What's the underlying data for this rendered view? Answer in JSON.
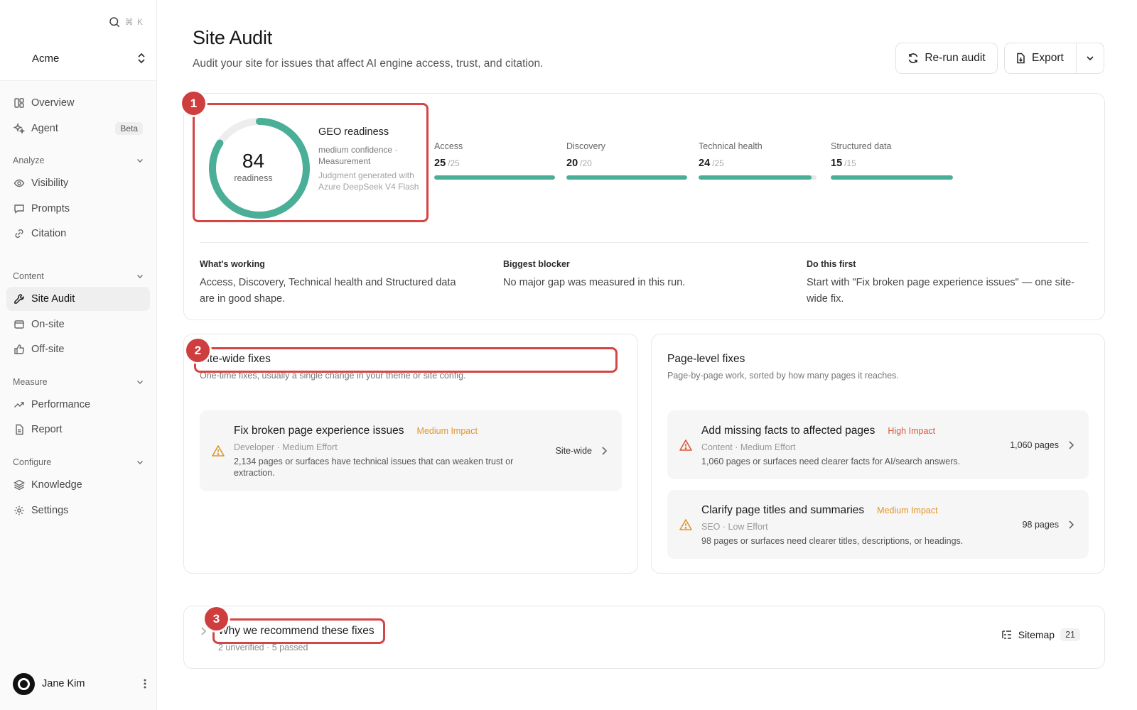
{
  "sidebar": {
    "search_shortcut": "⌘ K",
    "workspace": "Acme",
    "top_items": [
      {
        "label": "Overview",
        "icon": "layout-icon"
      },
      {
        "label": "Agent",
        "icon": "sparkle-icon",
        "badge": "Beta"
      }
    ],
    "sections": [
      {
        "title": "Analyze",
        "items": [
          {
            "label": "Visibility",
            "icon": "eye-icon"
          },
          {
            "label": "Prompts",
            "icon": "message-icon"
          },
          {
            "label": "Citation",
            "icon": "link-icon"
          }
        ]
      },
      {
        "title": "Content",
        "items": [
          {
            "label": "Site Audit",
            "icon": "wrench-icon",
            "active": true
          },
          {
            "label": "On-site",
            "icon": "browser-icon"
          },
          {
            "label": "Off-site",
            "icon": "thumbs-up-icon"
          }
        ]
      },
      {
        "title": "Measure",
        "items": [
          {
            "label": "Performance",
            "icon": "trend-icon"
          },
          {
            "label": "Report",
            "icon": "file-icon"
          }
        ]
      },
      {
        "title": "Configure",
        "items": [
          {
            "label": "Knowledge",
            "icon": "layers-icon"
          },
          {
            "label": "Settings",
            "icon": "gear-icon"
          }
        ]
      }
    ],
    "user": {
      "name": "Jane Kim"
    }
  },
  "header": {
    "title": "Site Audit",
    "subtitle": "Audit your site for issues that affect AI engine access, trust, and citation.",
    "rerun_label": "Re-run audit",
    "export_label": "Export"
  },
  "overview": {
    "marker": "1",
    "score": "84",
    "score_fraction": 0.84,
    "score_label": "readiness",
    "geo_title": "GEO readiness",
    "confidence": "medium confidence · Measurement",
    "judgment": "Judgment generated with Azure DeepSeek V4 Flash",
    "metrics": [
      {
        "label": "Access",
        "value": "25",
        "max": "/25",
        "fraction": 1.0
      },
      {
        "label": "Discovery",
        "value": "20",
        "max": "/20",
        "fraction": 1.0
      },
      {
        "label": "Technical health",
        "value": "24",
        "max": "/25",
        "fraction": 0.96
      },
      {
        "label": "Structured data",
        "value": "15",
        "max": "/15",
        "fraction": 1.0
      }
    ],
    "insights": [
      {
        "heading": "What's working",
        "text": "Access, Discovery, Technical health and Structured data are in good shape."
      },
      {
        "heading": "Biggest blocker",
        "text": "No major gap was measured in this run."
      },
      {
        "heading": "Do this first",
        "text": "Start with \"Fix broken page experience issues\" — one site-wide fix."
      }
    ]
  },
  "site_wide": {
    "marker": "2",
    "title": "Site-wide fixes",
    "subtitle": "One-time fixes, usually a single change in your theme or site config.",
    "fixes": [
      {
        "title": "Fix broken page experience issues",
        "impact": "Medium Impact",
        "meta": "Developer · Medium Effort",
        "desc": "2,134 pages or surfaces have technical issues that can weaken trust or extraction.",
        "scope": "Site-wide"
      }
    ]
  },
  "page_level": {
    "title": "Page-level fixes",
    "subtitle": "Page-by-page work, sorted by how many pages it reaches.",
    "fixes": [
      {
        "title": "Add missing facts to affected pages",
        "impact": "High Impact",
        "meta": "Content · Medium Effort",
        "desc": "1,060 pages or surfaces need clearer facts for AI/search answers.",
        "scope": "1,060 pages"
      },
      {
        "title": "Clarify page titles and summaries",
        "impact": "Medium Impact",
        "meta": "SEO · Low Effort",
        "desc": "98 pages or surfaces need clearer titles, descriptions, or headings.",
        "scope": "98 pages"
      }
    ]
  },
  "why": {
    "marker": "3",
    "title": "Why we recommend these fixes",
    "subtitle": "2 unverified · 5 passed",
    "sitemap_label": "Sitemap",
    "sitemap_count": "21"
  },
  "colors": {
    "accent_green": "#4aaf96",
    "highlight_red": "#d54545",
    "impact_medium": "#e0962a",
    "impact_high": "#dc5637"
  }
}
